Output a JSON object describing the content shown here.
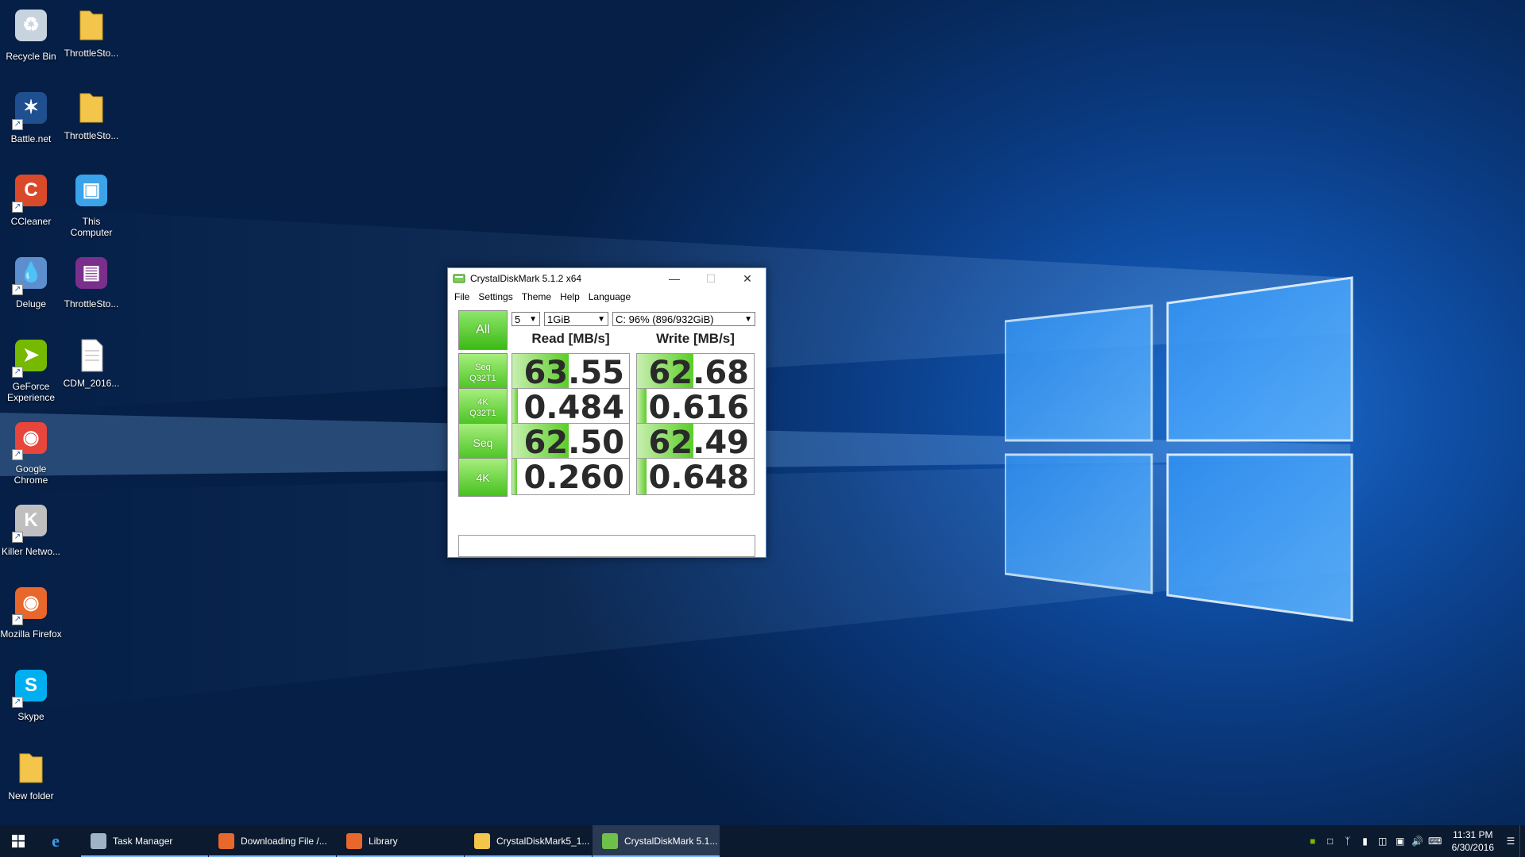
{
  "desktop": {
    "icons": [
      {
        "label": "Recycle Bin",
        "icon": "recycle-bin-icon"
      },
      {
        "label": "ThrottleSto...",
        "icon": "folder-icon"
      },
      {
        "label": "Battle.net",
        "icon": "battlenet-icon"
      },
      {
        "label": "ThrottleSto...",
        "icon": "folder-icon"
      },
      {
        "label": "CCleaner",
        "icon": "ccleaner-icon"
      },
      {
        "label": "This Computer",
        "icon": "computer-icon"
      },
      {
        "label": "Deluge",
        "icon": "deluge-icon"
      },
      {
        "label": "ThrottleSto...",
        "icon": "archive-icon"
      },
      {
        "label": "GeForce Experience",
        "icon": "geforce-icon"
      },
      {
        "label": "CDM_2016...",
        "icon": "text-file-icon"
      },
      {
        "label": "Google Chrome",
        "icon": "chrome-icon"
      },
      {
        "label": "Killer Netwo...",
        "icon": "killer-network-icon"
      },
      {
        "label": "Mozilla Firefox",
        "icon": "firefox-icon"
      },
      {
        "label": "Skype",
        "icon": "skype-icon"
      },
      {
        "label": "New folder",
        "icon": "folder-icon"
      }
    ]
  },
  "cdm": {
    "title": "CrystalDiskMark 5.1.2 x64",
    "menu": [
      "File",
      "Settings",
      "Theme",
      "Help",
      "Language"
    ],
    "all_label": "All",
    "count": "5",
    "size": "1GiB",
    "drive": "C: 96% (896/932GiB)",
    "read_header": "Read [MB/s]",
    "write_header": "Write [MB/s]",
    "rows": [
      {
        "label1": "Seq",
        "label2": "Q32T1",
        "read": "63.55",
        "write": "62.68",
        "read_fill": 0.48,
        "write_fill": 0.48
      },
      {
        "label1": "4K",
        "label2": "Q32T1",
        "read": "0.484",
        "write": "0.616",
        "read_fill": 0.05,
        "write_fill": 0.08
      },
      {
        "label1": "Seq",
        "label2": "",
        "read": "62.50",
        "write": "62.49",
        "read_fill": 0.48,
        "write_fill": 0.48
      },
      {
        "label1": "4K",
        "label2": "",
        "read": "0.260",
        "write": "0.648",
        "read_fill": 0.04,
        "write_fill": 0.08
      }
    ]
  },
  "taskbar": {
    "tasks": [
      {
        "label": "Task Manager",
        "icon": "task-manager-icon",
        "color": "#9fb3c8"
      },
      {
        "label": "Downloading File /...",
        "icon": "firefox-icon",
        "color": "#e8672a"
      },
      {
        "label": "Library",
        "icon": "firefox-icon",
        "color": "#e8672a"
      },
      {
        "label": "CrystalDiskMark5_1...",
        "icon": "folder-icon",
        "color": "#f3c64b"
      },
      {
        "label": "CrystalDiskMark 5.1...",
        "icon": "crystaldiskmark-icon",
        "color": "#6fc04a"
      }
    ],
    "time": "11:31 PM",
    "date": "6/30/2016"
  }
}
